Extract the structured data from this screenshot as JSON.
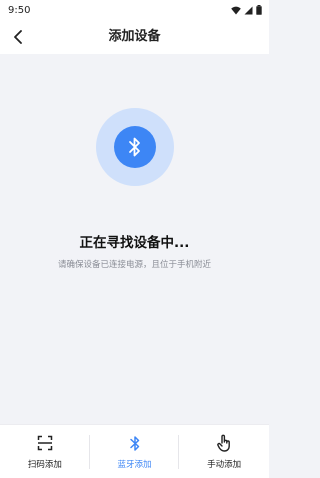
{
  "status_bar": {
    "time": "9:50"
  },
  "header": {
    "title": "添加设备",
    "back_icon": "chevron-left-icon"
  },
  "main": {
    "bluetooth_icon": "bluetooth-icon",
    "searching_title": "正在寻找设备中...",
    "hint": "请确保设备已连接电源，且位于手机附近"
  },
  "tabs": [
    {
      "label": "扫码添加",
      "icon": "scan-icon",
      "active": false
    },
    {
      "label": "蓝牙添加",
      "icon": "bluetooth-icon",
      "active": true
    },
    {
      "label": "手动添加",
      "icon": "hand-pointer-icon",
      "active": false
    }
  ],
  "colors": {
    "accent": "#3d86f5",
    "accent_light": "#cfe0fb",
    "background": "#f2f3f7"
  }
}
